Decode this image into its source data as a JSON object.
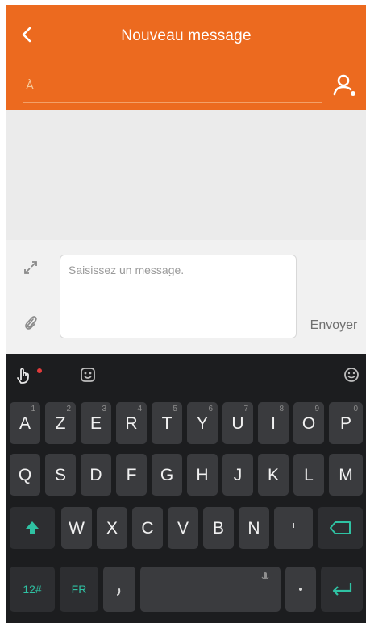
{
  "header": {
    "title": "Nouveau message",
    "to_label": "À",
    "back_icon": "chevron-left-icon",
    "contact_icon": "add-contact-icon",
    "background_color": "#ec6a1f"
  },
  "composer": {
    "placeholder": "Saisissez un message.",
    "send_label": "Envoyer",
    "expand_icon": "expand-icon",
    "attach_icon": "attach-icon"
  },
  "keyboard": {
    "toolbar": {
      "gesture_icon": "gesture-icon",
      "emoji_icon": "emoji-icon",
      "face_icon": "face-icon"
    },
    "row1": [
      {
        "label": "A",
        "hint": "1"
      },
      {
        "label": "Z",
        "hint": "2"
      },
      {
        "label": "E",
        "hint": "3"
      },
      {
        "label": "R",
        "hint": "4"
      },
      {
        "label": "T",
        "hint": "5"
      },
      {
        "label": "Y",
        "hint": "6"
      },
      {
        "label": "U",
        "hint": "7"
      },
      {
        "label": "I",
        "hint": "8"
      },
      {
        "label": "O",
        "hint": "9"
      },
      {
        "label": "P",
        "hint": "0"
      }
    ],
    "row2": [
      {
        "label": "Q"
      },
      {
        "label": "S"
      },
      {
        "label": "D"
      },
      {
        "label": "F"
      },
      {
        "label": "G"
      },
      {
        "label": "H"
      },
      {
        "label": "J"
      },
      {
        "label": "K"
      },
      {
        "label": "L"
      },
      {
        "label": "M"
      }
    ],
    "row3": [
      {
        "label": "W"
      },
      {
        "label": "X"
      },
      {
        "label": "C"
      },
      {
        "label": "V"
      },
      {
        "label": "B"
      },
      {
        "label": "N"
      }
    ],
    "bottom": {
      "numbers_label": "12#",
      "lang_label": "FR",
      "accent_color": "#2fc2a3"
    }
  }
}
